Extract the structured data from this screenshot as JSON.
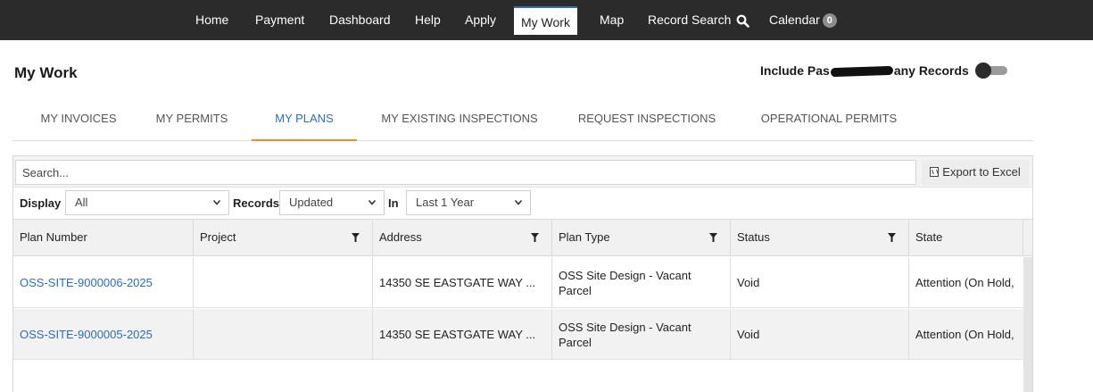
{
  "nav": {
    "items": [
      {
        "label": "Home"
      },
      {
        "label": "Payment"
      },
      {
        "label": "Dashboard"
      },
      {
        "label": "Help"
      },
      {
        "label": "Apply"
      },
      {
        "label": "My Work"
      },
      {
        "label": "Map"
      },
      {
        "label": "Record Search"
      },
      {
        "label": "Calendar"
      }
    ],
    "active": "My Work",
    "calendar_badge": "0"
  },
  "page": {
    "title": "My Work",
    "include_label_prefix": "Include Pas",
    "include_label_suffix": "any Records",
    "include_toggle_on": false
  },
  "tabs": [
    {
      "label": "MY INVOICES"
    },
    {
      "label": "MY PERMITS"
    },
    {
      "label": "MY PLANS"
    },
    {
      "label": "MY EXISTING INSPECTIONS"
    },
    {
      "label": "REQUEST INSPECTIONS"
    },
    {
      "label": "OPERATIONAL PERMITS"
    }
  ],
  "active_tab": "MY PLANS",
  "grid": {
    "search_placeholder": "Search...",
    "export_label": "Export to Excel",
    "filters": {
      "display_label": "Display",
      "display_value": "All",
      "records_label": "Records",
      "records_value": "Updated",
      "in_label": "In",
      "in_value": "Last 1 Year"
    },
    "columns": [
      {
        "label": "Plan Number"
      },
      {
        "label": "Project"
      },
      {
        "label": "Address"
      },
      {
        "label": "Plan Type"
      },
      {
        "label": "Status"
      },
      {
        "label": "State"
      }
    ],
    "rows": [
      {
        "plan_number": "OSS-SITE-9000006-2025",
        "project": "",
        "address": "14350 SE EASTGATE WAY ...",
        "plan_type": "OSS Site Design - Vacant Parcel",
        "status": "Void",
        "state": "Attention (On Hold,"
      },
      {
        "plan_number": "OSS-SITE-9000005-2025",
        "project": "",
        "address": "14350 SE EASTGATE WAY ...",
        "plan_type": "OSS Site Design - Vacant Parcel",
        "status": "Void",
        "state": "Attention (On Hold,"
      }
    ]
  },
  "colors": {
    "nav_bg": "#2b2b2b",
    "link": "#2a6db5",
    "active_tab_underline": "#f08a24"
  }
}
